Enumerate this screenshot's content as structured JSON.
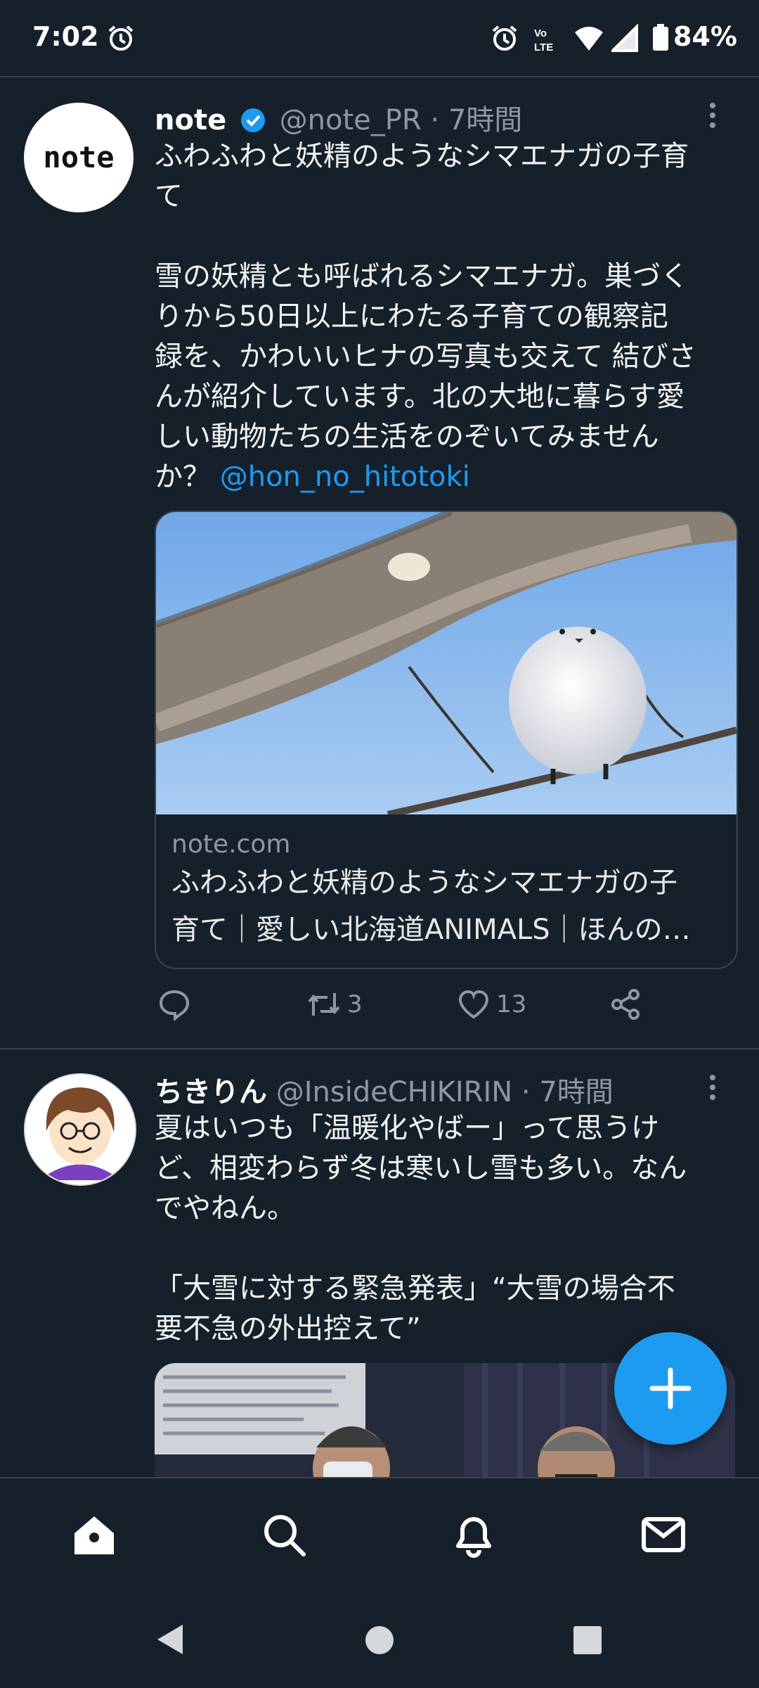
{
  "status_bar": {
    "time": "7:02",
    "battery": "84%",
    "icons": [
      "alarm-icon",
      "volte-icon",
      "wifi-icon",
      "signal-icon",
      "battery-icon"
    ]
  },
  "tweets": [
    {
      "name": "note",
      "verified": true,
      "handle": "@note_PR",
      "time": "· 7時間",
      "lines": [
        "ふわふわと妖精のようなシマエナガの子育",
        "て",
        "",
        "雪の妖精とも呼ばれるシマエナガ。巣づく",
        "りから50日以上にわたる子育ての観察記",
        "録を、かわいいヒナの写真も交えて 結びさ",
        "んが紹介しています。北の大地に暮らす愛",
        "しい動物たちの生活をのぞいてみません",
        "か？"
      ],
      "mention": "@hon_no_hitotoki",
      "card": {
        "domain": "note.com",
        "title_line1": "ふわふわと妖精のようなシマエナガの子",
        "title_line2": "育て｜愛しい北海道ANIMALS｜ほんの…"
      },
      "actions": {
        "reply": "",
        "retweets": "3",
        "likes": "13"
      }
    },
    {
      "name": "ちきりん",
      "handle": "@InsideCHIKIRIN",
      "time": "· 7時間",
      "lines": [
        "夏はいつも「温暖化やばー」って思うけ",
        "ど、相変わらず冬は寒いし雪も多い。なん",
        "でやねん。",
        "",
        "「大雪に対する緊急発表」“大雪の場合不",
        "要不急の外出控えて”"
      ]
    }
  ],
  "nav": {
    "items": [
      "home-icon",
      "search-icon",
      "notifications-icon",
      "messages-icon"
    ],
    "fab": "compose-tweet-button"
  },
  "colors": {
    "background": "#15202b",
    "accent": "#1d9bf0",
    "secondary_text": "#8b98a5"
  }
}
